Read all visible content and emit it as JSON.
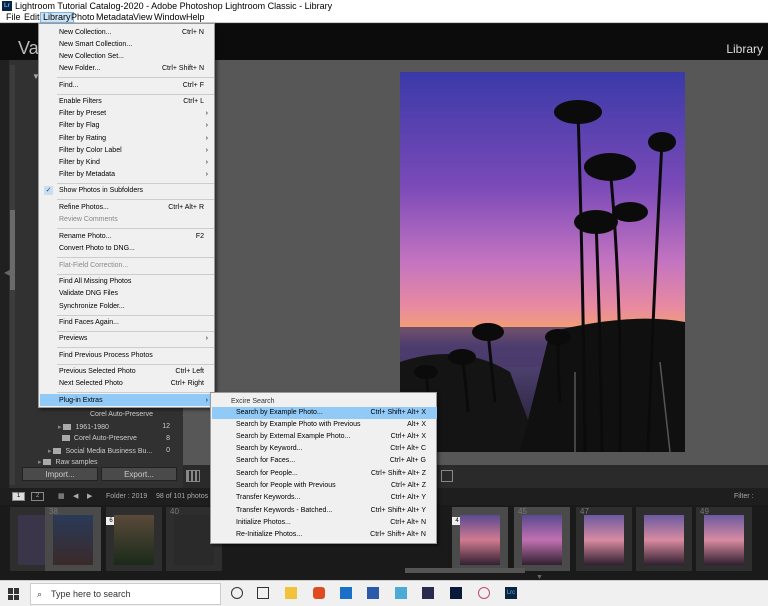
{
  "window": {
    "title": "Lightroom Tutorial Catalog-2020 - Adobe Photoshop Lightroom Classic - Library",
    "app_badge": "Lrc"
  },
  "menubar": [
    "File",
    "Edit",
    "Library",
    "Photo",
    "Metadata",
    "View",
    "Window",
    "Help"
  ],
  "module": {
    "left_text": "Va",
    "right_text": "Library"
  },
  "library_menu": {
    "items": [
      {
        "label": "New Collection...",
        "shortcut": "Ctrl+ N"
      },
      {
        "label": "New Smart Collection...",
        "shortcut": ""
      },
      {
        "label": "New Collection Set...",
        "shortcut": ""
      },
      {
        "label": "New Folder...",
        "shortcut": "Ctrl+ Shift+ N"
      },
      {
        "label": "Find...",
        "shortcut": "Ctrl+ F"
      },
      {
        "label": "Enable Filters",
        "shortcut": "Ctrl+ L"
      },
      {
        "label": "Filter by Preset",
        "shortcut": ""
      },
      {
        "label": "Filter by Flag",
        "shortcut": ""
      },
      {
        "label": "Filter by Rating",
        "shortcut": ""
      },
      {
        "label": "Filter by Color Label",
        "shortcut": ""
      },
      {
        "label": "Filter by Kind",
        "shortcut": ""
      },
      {
        "label": "Filter by Metadata",
        "shortcut": ""
      },
      {
        "label": "Show Photos in Subfolders",
        "shortcut": ""
      },
      {
        "label": "Refine Photos...",
        "shortcut": "Ctrl+ Alt+ R"
      },
      {
        "label": "Review Comments",
        "shortcut": ""
      },
      {
        "label": "Rename Photo...",
        "shortcut": "F2"
      },
      {
        "label": "Convert Photo to DNG...",
        "shortcut": ""
      },
      {
        "label": "Flat-Field Correction...",
        "shortcut": ""
      },
      {
        "label": "Find All Missing Photos",
        "shortcut": ""
      },
      {
        "label": "Validate DNG Files",
        "shortcut": ""
      },
      {
        "label": "Synchronize Folder...",
        "shortcut": ""
      },
      {
        "label": "Find Faces Again...",
        "shortcut": ""
      },
      {
        "label": "Previews",
        "shortcut": ""
      },
      {
        "label": "Find Previous Process Photos",
        "shortcut": ""
      },
      {
        "label": "Previous Selected Photo",
        "shortcut": "Ctrl+ Left"
      },
      {
        "label": "Next Selected Photo",
        "shortcut": "Ctrl+ Right"
      },
      {
        "label": "Plug-in Extras",
        "shortcut": ""
      }
    ]
  },
  "plugin_submenu": {
    "header": "Excire Search",
    "items": [
      {
        "label": "Search by Example Photo...",
        "shortcut": "Ctrl+ Shift+ Alt+ X"
      },
      {
        "label": "Search by Example Photo with Previous",
        "shortcut": "Alt+ X"
      },
      {
        "label": "Search by External Example Photo...",
        "shortcut": "Ctrl+ Alt+ X"
      },
      {
        "label": "Search by Keyword...",
        "shortcut": "Ctrl+ Alt+ C"
      },
      {
        "label": "Search for Faces...",
        "shortcut": "Ctrl+ Alt+ G"
      },
      {
        "label": "Search for People...",
        "shortcut": "Ctrl+ Shift+ Alt+ Z"
      },
      {
        "label": "Search for People with Previous",
        "shortcut": "Ctrl+ Alt+ Z"
      },
      {
        "label": "Transfer Keywords...",
        "shortcut": "Ctrl+ Alt+ Y"
      },
      {
        "label": "Transfer Keywords - Batched...",
        "shortcut": "Ctrl+ Shift+ Alt+ Y"
      },
      {
        "label": "Initialize Photos...",
        "shortcut": "Ctrl+ Alt+ N"
      },
      {
        "label": "Re-Initialize Photos...",
        "shortcut": "Ctrl+ Shift+ Alt+ N"
      }
    ]
  },
  "folders": [
    {
      "name": "Corel Auto-Preserve",
      "count": "15"
    },
    {
      "name": "1961-1980",
      "count": "12"
    },
    {
      "name": "Corel Auto-Preserve",
      "count": "8"
    },
    {
      "name": "Social Media Business Bu...",
      "count": "0"
    },
    {
      "name": "Raw samples",
      "count": ""
    }
  ],
  "left_buttons": {
    "import": "Import...",
    "export": "Export..."
  },
  "filmbar": {
    "page1": "1",
    "page2": "2",
    "folder_info": "Folder : 2019",
    "count_info": "98 of 101 photos /",
    "filter_label": "Filter :"
  },
  "filmstrip": {
    "numbers": [
      "",
      "38",
      "",
      "40",
      "",
      "",
      "",
      "",
      "45",
      "46",
      "47",
      "",
      "49",
      ""
    ],
    "badges": [
      "",
      "",
      "6",
      "",
      "",
      "",
      "",
      "4",
      "",
      "4",
      "",
      "",
      "",
      ""
    ]
  },
  "taskbar": {
    "search_placeholder": "Type here to search"
  }
}
